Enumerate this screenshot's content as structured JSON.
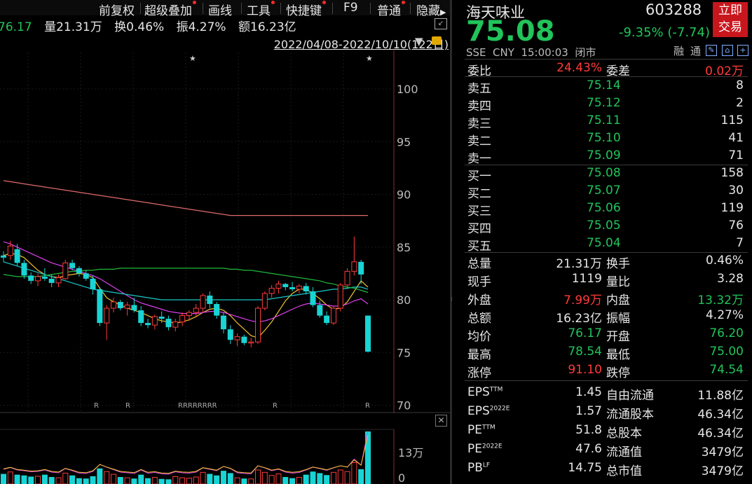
{
  "toolbar": {
    "items": [
      "前复权",
      "超级叠加",
      "画线",
      "工具",
      "快捷键",
      "F9",
      "普通",
      "隐藏"
    ]
  },
  "info": {
    "avg": "76.17",
    "vol": "量21.31万",
    "turn": "换0.46%",
    "amp": "振4.27%",
    "amt": "额16.23亿"
  },
  "range": "2022/04/08-2022/10/10(122日)",
  "axis": {
    "prices": [
      "100",
      "95",
      "90",
      "85",
      "80",
      "75",
      "70"
    ],
    "vol_labels": [
      "13万",
      "0"
    ]
  },
  "stock": {
    "name": "海天味业",
    "code": "603288",
    "price": "75.08",
    "change": "-9.35% (-7.74)",
    "market": "SSE  CNY  15:00:03  闭市",
    "trade1": "立即",
    "trade2": "交易",
    "tags": [
      "融",
      "通"
    ]
  },
  "webi": {
    "l1": "委比",
    "v1": "24.43%",
    "l2": "委差",
    "v2": "0.02万"
  },
  "asks": [
    [
      "卖五",
      "75.14",
      "8"
    ],
    [
      "卖四",
      "75.12",
      "2"
    ],
    [
      "卖三",
      "75.11",
      "115"
    ],
    [
      "卖二",
      "75.10",
      "41"
    ],
    [
      "卖一",
      "75.09",
      "71"
    ]
  ],
  "bids": [
    [
      "买一",
      "75.08",
      "158"
    ],
    [
      "买二",
      "75.07",
      "30"
    ],
    [
      "买三",
      "75.06",
      "119"
    ],
    [
      "买四",
      "75.05",
      "76"
    ],
    [
      "买五",
      "75.04",
      "7"
    ]
  ],
  "stats": [
    [
      "总量",
      "21.31万",
      "white",
      "换手",
      "0.46%",
      "white"
    ],
    [
      "现手",
      "1119",
      "white",
      "量比",
      "3.28",
      "white"
    ],
    [
      "外盘",
      "7.99万",
      "red",
      "内盘",
      "13.32万",
      "green"
    ],
    [
      "总额",
      "16.23亿",
      "white",
      "振幅",
      "4.27%",
      "white"
    ],
    [
      "均价",
      "76.17",
      "green",
      "开盘",
      "76.20",
      "green"
    ],
    [
      "最高",
      "78.54",
      "green",
      "最低",
      "75.00",
      "green"
    ],
    [
      "涨停",
      "91.10",
      "red",
      "跌停",
      "74.54",
      "green"
    ]
  ],
  "fin": [
    [
      "EPS",
      "TTM",
      "1.45",
      "自由流通",
      "11.88亿"
    ],
    [
      "EPS",
      "2022E",
      "1.57",
      "流通股本",
      "46.34亿"
    ],
    [
      "PE",
      "TTM",
      "51.8",
      "总股本",
      "46.34亿"
    ],
    [
      "PE",
      "2022E",
      "47.6",
      "流通值",
      "3479亿"
    ],
    [
      "PB",
      "LF",
      "14.75",
      "总市值",
      "3479亿"
    ]
  ],
  "chart_data": {
    "type": "candlestick",
    "ylim": [
      70,
      102
    ],
    "candles": [
      [
        84.2,
        84.6,
        83.6,
        84.0
      ],
      [
        84.2,
        85.6,
        83.8,
        85.1
      ],
      [
        84.8,
        85.3,
        83.2,
        83.5
      ],
      [
        83.5,
        83.8,
        82.0,
        82.3
      ],
      [
        82.3,
        82.6,
        81.5,
        81.8
      ],
      [
        81.8,
        82.5,
        81.3,
        82.2
      ],
      [
        82.2,
        83.0,
        81.8,
        82.0
      ],
      [
        82.0,
        82.4,
        81.2,
        81.6
      ],
      [
        81.6,
        82.4,
        81.2,
        82.1
      ],
      [
        82.0,
        83.8,
        81.9,
        83.5
      ],
      [
        83.5,
        83.8,
        82.8,
        83.0
      ],
      [
        83.0,
        83.2,
        82.2,
        82.5
      ],
      [
        82.5,
        82.8,
        81.8,
        82.0
      ],
      [
        82.0,
        82.3,
        80.5,
        81.0
      ],
      [
        81.0,
        81.2,
        77.5,
        77.8
      ],
      [
        77.8,
        79.5,
        76.2,
        79.2
      ],
      [
        79.2,
        80.2,
        78.8,
        79.8
      ],
      [
        79.8,
        80.0,
        79.0,
        79.2
      ],
      [
        79.2,
        79.8,
        78.5,
        79.5
      ],
      [
        79.5,
        80.2,
        78.8,
        79.0
      ],
      [
        79.0,
        79.4,
        77.5,
        77.8
      ],
      [
        77.8,
        78.2,
        77.3,
        77.6
      ],
      [
        77.6,
        78.6,
        77.2,
        78.4
      ],
      [
        78.4,
        78.9,
        77.8,
        78.2
      ],
      [
        78.2,
        78.5,
        77.1,
        77.4
      ],
      [
        77.4,
        78.2,
        77.0,
        77.9
      ],
      [
        77.9,
        78.8,
        77.5,
        78.5
      ],
      [
        78.5,
        79.0,
        78.0,
        78.8
      ],
      [
        78.8,
        79.6,
        78.4,
        79.2
      ],
      [
        79.2,
        80.6,
        78.8,
        80.4
      ],
      [
        80.4,
        80.8,
        79.2,
        79.6
      ],
      [
        79.6,
        79.8,
        78.2,
        78.5
      ],
      [
        78.5,
        78.8,
        76.8,
        77.2
      ],
      [
        77.2,
        77.6,
        75.8,
        76.2
      ],
      [
        76.2,
        76.8,
        75.6,
        76.5
      ],
      [
        76.5,
        76.7,
        75.7,
        75.9
      ],
      [
        75.9,
        76.4,
        75.5,
        76.0
      ],
      [
        76.0,
        79.4,
        75.8,
        79.2
      ],
      [
        79.2,
        80.8,
        79.0,
        80.6
      ],
      [
        80.6,
        81.4,
        80.2,
        81.1
      ],
      [
        81.1,
        81.8,
        80.6,
        81.5
      ],
      [
        81.5,
        81.6,
        80.9,
        81.2
      ],
      [
        81.2,
        81.7,
        80.8,
        81.0
      ],
      [
        81.0,
        81.5,
        80.6,
        81.3
      ],
      [
        81.3,
        81.6,
        80.5,
        80.8
      ],
      [
        80.8,
        81.2,
        79.3,
        79.5
      ],
      [
        79.5,
        79.9,
        78.3,
        78.5
      ],
      [
        78.5,
        78.9,
        77.6,
        77.8
      ],
      [
        77.8,
        79.4,
        77.6,
        79.2
      ],
      [
        79.2,
        81.6,
        78.9,
        81.4
      ],
      [
        81.4,
        83.0,
        81.0,
        82.7
      ],
      [
        82.7,
        86.0,
        82.3,
        83.6
      ],
      [
        83.6,
        83.8,
        81.5,
        82.4
      ],
      [
        78.5,
        78.5,
        75.0,
        75.08
      ]
    ],
    "ma": [
      {
        "color": "#f0c22a",
        "values": [
          84.2,
          84.4,
          84.3,
          84.0,
          83.4,
          82.8,
          82.4,
          82.2,
          82.1,
          82.3,
          82.4,
          82.5,
          82.4,
          82.1,
          81.1,
          80.2,
          79.8,
          79.5,
          79.2,
          79.0,
          78.8,
          78.5,
          78.2,
          78.0,
          77.9,
          77.8,
          77.9,
          78.1,
          78.4,
          78.8,
          79.1,
          79.2,
          79.0,
          78.5,
          77.8,
          77.2,
          76.6,
          76.4,
          77.1,
          77.9,
          78.9,
          79.9,
          80.6,
          81.0,
          81.0,
          80.6,
          80.1,
          79.5,
          79.1,
          79.2,
          79.8,
          80.8,
          81.8,
          81.2
        ]
      },
      {
        "color": "#e040f0",
        "values": [
          85.5,
          85.3,
          85.0,
          84.7,
          84.4,
          84.1,
          83.8,
          83.5,
          83.3,
          83.1,
          82.9,
          82.7,
          82.5,
          82.3,
          82.0,
          81.6,
          81.2,
          80.8,
          80.4,
          80.0,
          79.7,
          79.5,
          79.3,
          79.1,
          78.9,
          78.8,
          78.7,
          78.7,
          78.7,
          78.8,
          78.9,
          78.9,
          78.8,
          78.6,
          78.4,
          78.2,
          78.0,
          77.9,
          78.0,
          78.2,
          78.5,
          78.8,
          79.1,
          79.4,
          79.6,
          79.7,
          79.6,
          79.5,
          79.4,
          79.4,
          79.6,
          79.9,
          80.1,
          79.6
        ]
      },
      {
        "color": "#18c8c8",
        "values": [
          83.6,
          83.4,
          83.2,
          83.0,
          82.8,
          82.6,
          82.4,
          82.2,
          82.0,
          81.8,
          81.6,
          81.4,
          81.2,
          81.0,
          80.9,
          80.8,
          80.7,
          80.6,
          80.5,
          80.4,
          80.3,
          80.2,
          80.1,
          80.0,
          80.0,
          80.0,
          80.0,
          80.0,
          80.0,
          80.0,
          80.0,
          80.0,
          80.0,
          80.0,
          80.0,
          80.0,
          80.0,
          80.0,
          80.0,
          80.1,
          80.2,
          80.3,
          80.4,
          80.5,
          80.6,
          80.7,
          80.8,
          80.9,
          81.0,
          81.0,
          81.1,
          81.2,
          81.2,
          81.0
        ]
      },
      {
        "color": "#22b83a",
        "values": [
          82.4,
          82.3,
          82.2,
          82.2,
          82.2,
          82.2,
          82.3,
          82.4,
          82.5,
          82.6,
          82.7,
          82.7,
          82.8,
          82.8,
          82.9,
          82.9,
          82.9,
          83.0,
          83.0,
          83.0,
          83.0,
          83.0,
          83.0,
          83.0,
          83.0,
          83.0,
          83.0,
          83.0,
          83.0,
          83.0,
          83.0,
          83.0,
          83.0,
          82.9,
          82.9,
          82.8,
          82.8,
          82.7,
          82.6,
          82.5,
          82.4,
          82.3,
          82.2,
          82.1,
          82.0,
          81.9,
          81.8,
          81.6,
          81.5,
          81.3,
          81.2,
          81.1,
          80.9,
          80.7
        ]
      },
      {
        "color": "#e06a6a",
        "values": [
          91.3,
          91.2,
          91.1,
          91.0,
          90.9,
          90.8,
          90.7,
          90.6,
          90.5,
          90.4,
          90.3,
          90.2,
          90.1,
          90.0,
          89.9,
          89.8,
          89.7,
          89.6,
          89.5,
          89.4,
          89.3,
          89.2,
          89.1,
          89.0,
          88.9,
          88.8,
          88.7,
          88.6,
          88.5,
          88.4,
          88.3,
          88.2,
          88.1,
          88.0,
          88.0,
          88.0,
          88.0,
          88.0,
          88.0,
          88.0,
          88.0,
          88.0,
          88.0,
          88.0,
          88.0,
          88.0,
          88.0,
          88.0,
          88.0,
          88.0,
          88.0,
          88.0,
          88.0,
          88.0
        ]
      }
    ],
    "volume": [
      2.6,
      3.1,
      2.4,
      2.2,
      1.9,
      2.0,
      2.4,
      1.8,
      1.6,
      2.8,
      2.2,
      1.5,
      1.4,
      2.0,
      4.0,
      3.2,
      2.5,
      1.8,
      1.6,
      1.4,
      2.4,
      1.5,
      1.7,
      1.3,
      1.2,
      1.9,
      1.6,
      1.5,
      1.8,
      3.0,
      2.6,
      2.2,
      3.4,
      2.8,
      1.6,
      1.4,
      1.3,
      3.6,
      3.0,
      2.2,
      2.6,
      1.8,
      1.5,
      1.7,
      2.4,
      3.2,
      2.8,
      2.3,
      3.0,
      3.6,
      3.2,
      5.5,
      3.8,
      13.5
    ]
  }
}
